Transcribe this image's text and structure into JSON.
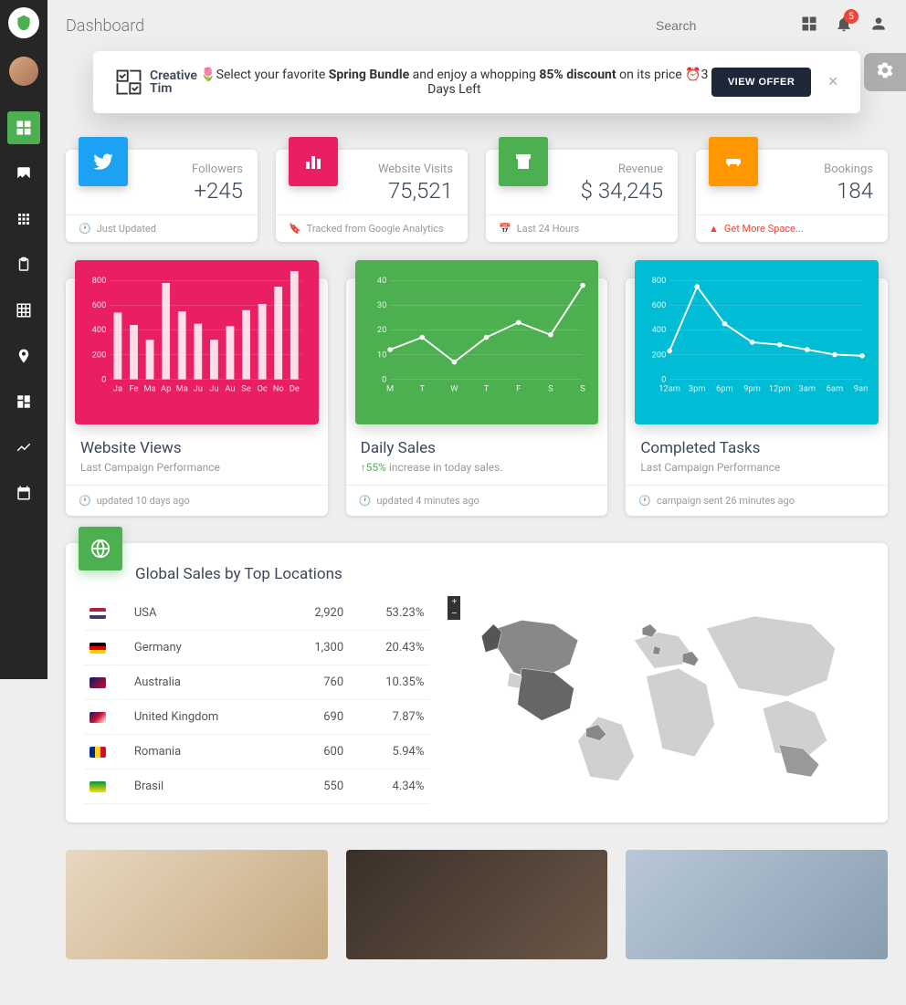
{
  "page_title": "Dashboard",
  "search_placeholder": "Search",
  "notification_count": "5",
  "banner": {
    "logo1": "Creative",
    "logo2": "Tim",
    "pre": "Select your favorite ",
    "bold1": "Spring Bundle",
    "mid": " and enjoy a whopping ",
    "bold2": "85% discount",
    "post": " on its price ",
    "days": "3 Days Left",
    "cta": "VIEW OFFER"
  },
  "stats": {
    "followers": {
      "label": "Followers",
      "value": "+245",
      "footer": "Just Updated"
    },
    "visits": {
      "label": "Website Visits",
      "value": "75,521",
      "footer": "Tracked from Google Analytics"
    },
    "revenue": {
      "label": "Revenue",
      "value": "$ 34,245",
      "footer": "Last 24 Hours"
    },
    "bookings": {
      "label": "Bookings",
      "value": "184",
      "footer": "Get More Space..."
    }
  },
  "charts": {
    "views": {
      "title": "Website Views",
      "subtitle": "Last Campaign Performance",
      "footer": "updated 10 days ago"
    },
    "sales": {
      "title": "Daily Sales",
      "arrow": "↑",
      "pct": "55%",
      "subtitle": " increase in today sales.",
      "footer": "updated 4 minutes ago"
    },
    "tasks": {
      "title": "Completed Tasks",
      "subtitle": "Last Campaign Performance",
      "footer": "campaign sent 26 minutes ago"
    }
  },
  "chart_data": [
    {
      "type": "bar",
      "title": "Website Views",
      "categories": [
        "Ja",
        "Fe",
        "Ma",
        "Ap",
        "Ma",
        "Ju",
        "Ju",
        "Au",
        "Se",
        "Oc",
        "No",
        "De"
      ],
      "values": [
        540,
        440,
        320,
        780,
        550,
        450,
        320,
        430,
        560,
        610,
        750,
        890
      ],
      "ylabel": "",
      "ylim": [
        0,
        800
      ],
      "yticks": [
        0,
        200,
        400,
        600,
        800
      ]
    },
    {
      "type": "line",
      "title": "Daily Sales",
      "categories": [
        "M",
        "T",
        "W",
        "T",
        "F",
        "S",
        "S"
      ],
      "values": [
        12,
        17,
        7,
        17,
        23,
        18,
        38
      ],
      "ylabel": "",
      "ylim": [
        0,
        40
      ],
      "yticks": [
        0,
        10,
        20,
        30,
        40
      ]
    },
    {
      "type": "line",
      "title": "Completed Tasks",
      "categories": [
        "12am",
        "3pm",
        "6pm",
        "9pm",
        "12pm",
        "3am",
        "6am",
        "9am"
      ],
      "values": [
        230,
        750,
        450,
        300,
        280,
        240,
        200,
        190
      ],
      "ylabel": "",
      "ylim": [
        0,
        800
      ],
      "yticks": [
        0,
        200,
        400,
        600,
        800
      ]
    }
  ],
  "map": {
    "title": "Global Sales by Top Locations",
    "rows": [
      {
        "country": "USA",
        "value": "2,920",
        "pct": "53.23%",
        "flag": "us"
      },
      {
        "country": "Germany",
        "value": "1,300",
        "pct": "20.43%",
        "flag": "de"
      },
      {
        "country": "Australia",
        "value": "760",
        "pct": "10.35%",
        "flag": "au"
      },
      {
        "country": "United Kingdom",
        "value": "690",
        "pct": "7.87%",
        "flag": "gb"
      },
      {
        "country": "Romania",
        "value": "600",
        "pct": "5.94%",
        "flag": "ro"
      },
      {
        "country": "Brasil",
        "value": "550",
        "pct": "4.34%",
        "flag": "br"
      }
    ]
  }
}
